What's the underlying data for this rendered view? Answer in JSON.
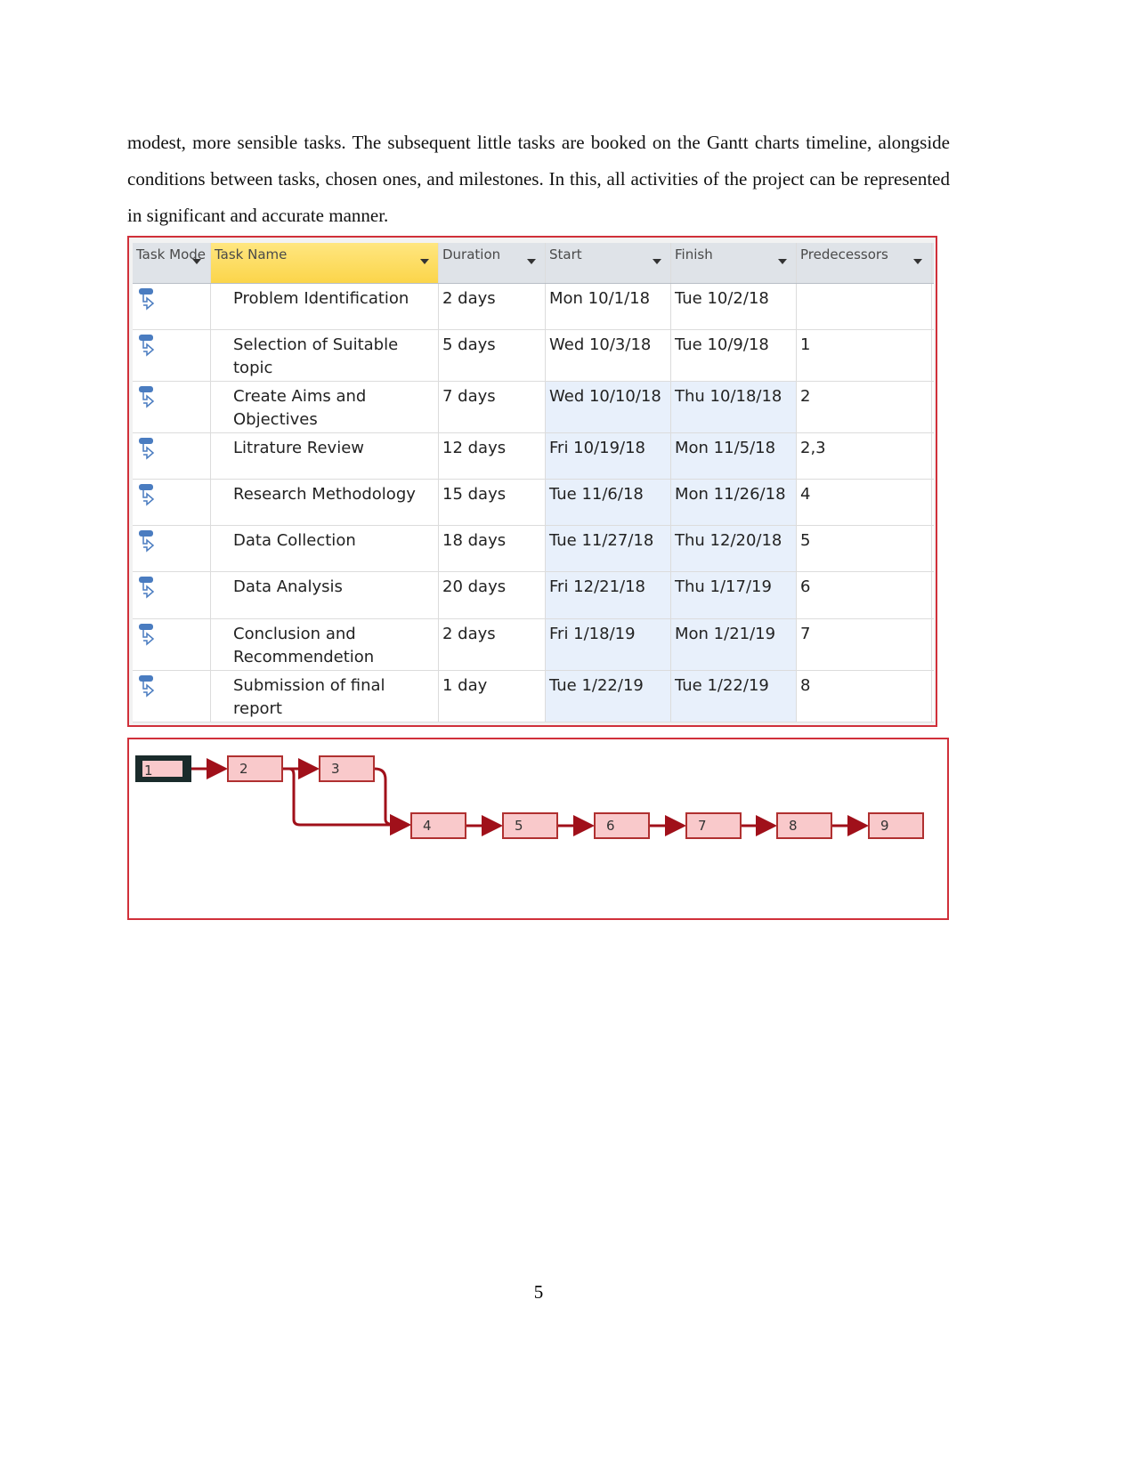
{
  "paragraph": "modest, more sensible tasks. The subsequent little tasks are booked on the Gantt charts timeline, alongside conditions between tasks, chosen ones, and milestones. In this, all activities of the project can be represented in significant and accurate manner.",
  "table": {
    "headers": [
      "Task Mode",
      "Task Name",
      "Duration",
      "Start",
      "Finish",
      "Predecessors"
    ],
    "mode_icon": "auto-scheduled-task-icon",
    "highlight_color": "#fbd54a",
    "rows": [
      {
        "name": "Problem Identification",
        "duration": "2 days",
        "start": "Mon 10/1/18",
        "finish": "Tue 10/2/18",
        "pred": ""
      },
      {
        "name": "Selection of Suitable topic",
        "duration": "5 days",
        "start": "Wed 10/3/18",
        "finish": "Tue 10/9/18",
        "pred": "1"
      },
      {
        "name": "Create Aims and Objectives",
        "duration": "7 days",
        "start": "Wed 10/10/18",
        "finish": "Thu 10/18/18",
        "pred": "2"
      },
      {
        "name": "Litrature Review",
        "duration": "12 days",
        "start": "Fri 10/19/18",
        "finish": "Mon 11/5/18",
        "pred": "2,3"
      },
      {
        "name": "Research Methodology",
        "duration": "15 days",
        "start": "Tue 11/6/18",
        "finish": "Mon 11/26/18",
        "pred": "4"
      },
      {
        "name": "Data Collection",
        "duration": "18 days",
        "start": "Tue 11/27/18",
        "finish": "Thu 12/20/18",
        "pred": "5"
      },
      {
        "name": "Data Analysis",
        "duration": "20 days",
        "start": "Fri 12/21/18",
        "finish": "Thu 1/17/19",
        "pred": "6"
      },
      {
        "name": "Conclusion and Recommendetion",
        "duration": "2 days",
        "start": "Fri 1/18/19",
        "finish": "Mon 1/21/19",
        "pred": "7"
      },
      {
        "name": "Submission of final report",
        "duration": "1 day",
        "start": "Tue 1/22/19",
        "finish": "Tue 1/22/19",
        "pred": "8"
      }
    ]
  },
  "network": {
    "nodes": [
      "1",
      "2",
      "3",
      "4",
      "5",
      "6",
      "7",
      "8",
      "9"
    ],
    "line_color": "#a0101a",
    "node_fill": "#f9c9cb"
  },
  "page_number": "5"
}
